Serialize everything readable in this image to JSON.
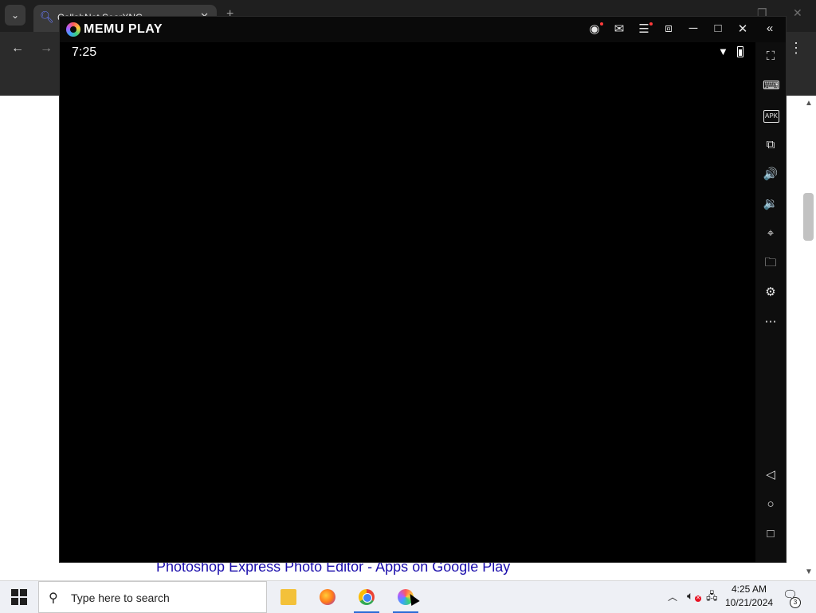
{
  "browser": {
    "tab_title": "CollabNet SearXNG",
    "tab_close": "✕",
    "new_tab": "+",
    "back": "←",
    "forward": "→",
    "menu": "⋮",
    "page_link": "Photoshop Express Photo Editor - Apps on Google Play"
  },
  "memu": {
    "brand": "MEMU PLAY",
    "titlebar_icons": [
      "account-icon",
      "mail-icon",
      "menu-icon",
      "screen-cast-icon",
      "minimize-icon",
      "maximize-icon",
      "close-icon",
      "collapse-sidebar-icon"
    ],
    "android": {
      "time": "7:25"
    },
    "side_toolbar": [
      {
        "name": "fullscreen-icon",
        "glyph": "⛶"
      },
      {
        "name": "keyboard-icon",
        "glyph": "⌨"
      },
      {
        "name": "apk-install-icon",
        "glyph": "APK"
      },
      {
        "name": "multi-instance-icon",
        "glyph": "⧉"
      },
      {
        "name": "volume-up-icon",
        "glyph": "🔊"
      },
      {
        "name": "volume-down-icon",
        "glyph": "🔉"
      },
      {
        "name": "location-icon",
        "glyph": "⌖"
      },
      {
        "name": "folder-icon",
        "glyph": "🗀"
      },
      {
        "name": "settings-icon",
        "glyph": "⚙"
      },
      {
        "name": "more-icon",
        "glyph": "⋯"
      },
      {
        "name": "android-back-icon",
        "glyph": "◁"
      },
      {
        "name": "android-home-icon",
        "glyph": "○"
      },
      {
        "name": "android-recents-icon",
        "glyph": "□"
      }
    ]
  },
  "taskbar": {
    "search_placeholder": "Type here to search",
    "apps": [
      "file-explorer-icon",
      "firefox-icon",
      "chrome-icon",
      "memu-icon"
    ],
    "clock_time": "4:25 AM",
    "clock_date": "10/21/2024",
    "notification_count": "3"
  }
}
